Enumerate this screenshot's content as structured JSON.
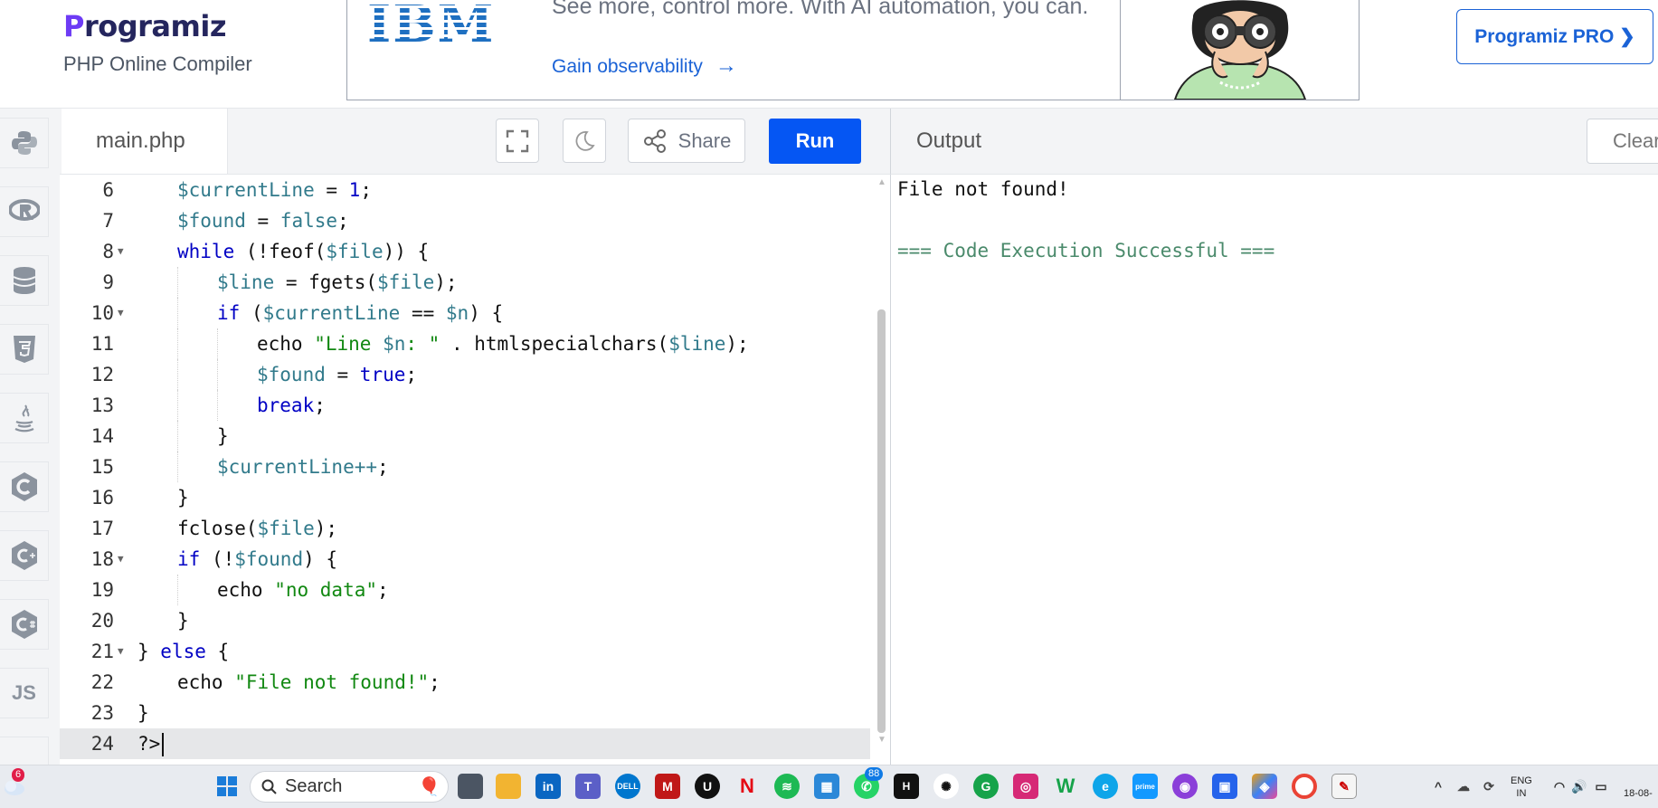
{
  "header": {
    "brand": "Programiz",
    "subtitle": "PHP Online Compiler",
    "pro_button": "Programiz PRO ❯"
  },
  "ad": {
    "logo": "IBM",
    "text": "See more, control more. With AI automation, you can.",
    "link": "Gain observability",
    "link_arrow": "→"
  },
  "sidebar": {
    "items": [
      "python-icon",
      "r-icon",
      "sql-icon",
      "html5-icon",
      "java-icon",
      "c-icon",
      "cpp-icon",
      "csharp-icon",
      "JS",
      "ts-icon"
    ]
  },
  "editor": {
    "file_tab": "main.php",
    "share_label": "Share",
    "run_label": "Run",
    "lines": [
      {
        "num": "6",
        "fold": false,
        "indent": 1,
        "tokens": [
          [
            "var",
            "$currentLine"
          ],
          [
            "plain",
            " = "
          ],
          [
            "num",
            "1"
          ],
          [
            "plain",
            ";"
          ]
        ]
      },
      {
        "num": "7",
        "fold": false,
        "indent": 1,
        "tokens": [
          [
            "var",
            "$found"
          ],
          [
            "plain",
            " = "
          ],
          [
            "var",
            "false"
          ],
          [
            "plain",
            ";"
          ]
        ]
      },
      {
        "num": "8",
        "fold": true,
        "indent": 1,
        "tokens": [
          [
            "kw",
            "while"
          ],
          [
            "plain",
            " (!feof("
          ],
          [
            "var",
            "$file"
          ],
          [
            "plain",
            ")) {"
          ]
        ]
      },
      {
        "num": "9",
        "fold": false,
        "indent": 2,
        "tokens": [
          [
            "var",
            "$line"
          ],
          [
            "plain",
            " = fgets("
          ],
          [
            "var",
            "$file"
          ],
          [
            "plain",
            ");"
          ]
        ]
      },
      {
        "num": "10",
        "fold": true,
        "indent": 2,
        "tokens": [
          [
            "kw",
            "if"
          ],
          [
            "plain",
            " ("
          ],
          [
            "var",
            "$currentLine"
          ],
          [
            "plain",
            " == "
          ],
          [
            "var",
            "$n"
          ],
          [
            "plain",
            ") {"
          ]
        ]
      },
      {
        "num": "11",
        "fold": false,
        "indent": 3,
        "tokens": [
          [
            "plain",
            "echo "
          ],
          [
            "str",
            "\"Line "
          ],
          [
            "var",
            "$n"
          ],
          [
            "str",
            ": \""
          ],
          [
            "plain",
            " . htmlspecialchars("
          ],
          [
            "var",
            "$line"
          ],
          [
            "plain",
            ");"
          ]
        ]
      },
      {
        "num": "12",
        "fold": false,
        "indent": 3,
        "tokens": [
          [
            "var",
            "$found"
          ],
          [
            "plain",
            " = "
          ],
          [
            "kw",
            "true"
          ],
          [
            "plain",
            ";"
          ]
        ]
      },
      {
        "num": "13",
        "fold": false,
        "indent": 3,
        "tokens": [
          [
            "kw",
            "break"
          ],
          [
            "plain",
            ";"
          ]
        ]
      },
      {
        "num": "14",
        "fold": false,
        "indent": 2,
        "tokens": [
          [
            "plain",
            "}"
          ]
        ]
      },
      {
        "num": "15",
        "fold": false,
        "indent": 2,
        "tokens": [
          [
            "var",
            "$currentLine++"
          ],
          [
            "plain",
            ";"
          ]
        ]
      },
      {
        "num": "16",
        "fold": false,
        "indent": 1,
        "tokens": [
          [
            "plain",
            "}"
          ]
        ]
      },
      {
        "num": "17",
        "fold": false,
        "indent": 1,
        "tokens": [
          [
            "plain",
            "fclose("
          ],
          [
            "var",
            "$file"
          ],
          [
            "plain",
            ");"
          ]
        ]
      },
      {
        "num": "18",
        "fold": true,
        "indent": 1,
        "tokens": [
          [
            "kw",
            "if"
          ],
          [
            "plain",
            " (!"
          ],
          [
            "var",
            "$found"
          ],
          [
            "plain",
            ") {"
          ]
        ]
      },
      {
        "num": "19",
        "fold": false,
        "indent": 2,
        "tokens": [
          [
            "plain",
            "echo "
          ],
          [
            "str",
            "\"no data\""
          ],
          [
            "plain",
            ";"
          ]
        ]
      },
      {
        "num": "20",
        "fold": false,
        "indent": 1,
        "tokens": [
          [
            "plain",
            "}"
          ]
        ]
      },
      {
        "num": "21",
        "fold": true,
        "indent": 0,
        "tokens": [
          [
            "plain",
            "} "
          ],
          [
            "kw",
            "else"
          ],
          [
            "plain",
            " {"
          ]
        ]
      },
      {
        "num": "22",
        "fold": false,
        "indent": 1,
        "tokens": [
          [
            "plain",
            "echo "
          ],
          [
            "str",
            "\"File not found!\""
          ],
          [
            "plain",
            ";"
          ]
        ]
      },
      {
        "num": "23",
        "fold": false,
        "indent": 0,
        "tokens": [
          [
            "plain",
            "}"
          ]
        ]
      },
      {
        "num": "24",
        "fold": false,
        "indent": 0,
        "tokens": [
          [
            "plain",
            "?>"
          ]
        ],
        "active": true
      }
    ]
  },
  "output": {
    "title": "Output",
    "clear_label": "Clear",
    "lines": [
      "File not found!",
      "=== Code Execution Successful ==="
    ]
  },
  "taskbar": {
    "weather_badge": "6",
    "search_label": "Search",
    "whatsapp_badge": "88",
    "lang_line1": "ENG",
    "lang_line2": "IN",
    "date_partial": "18-08-"
  },
  "colors": {
    "run_button": "#0556f3",
    "brand": "#6d3bf5",
    "variable": "#317a8b",
    "keyword": "#0000c4",
    "string": "#118811",
    "success_text": "#4a8a6b"
  }
}
